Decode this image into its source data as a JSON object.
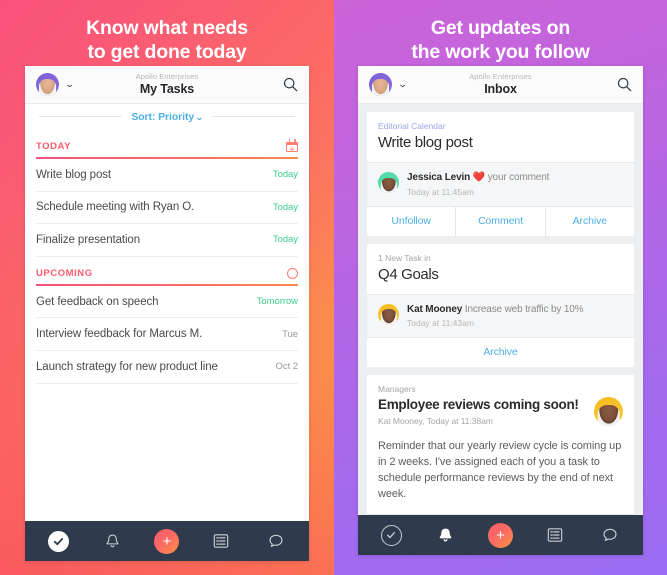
{
  "left": {
    "headline_line1": "Know what needs",
    "headline_line2": "to get done today",
    "appbar": {
      "org": "Apollo Enterprises",
      "title": "My Tasks",
      "avatar": "user-avatar",
      "chevron": "chevron-down-icon",
      "search": "search-icon"
    },
    "sort": {
      "label": "Sort: Priority",
      "chevron": "⌄"
    },
    "sections": [
      {
        "label": "TODAY",
        "icon": "calendar-icon",
        "tasks": [
          {
            "name": "Write blog post",
            "date": "Today",
            "tone": "green"
          },
          {
            "name": "Schedule meeting with Ryan O.",
            "date": "Today",
            "tone": "green"
          },
          {
            "name": "Finalize presentation",
            "date": "Today",
            "tone": "green"
          }
        ]
      },
      {
        "label": "UPCOMING",
        "icon": "circle-icon",
        "tasks": [
          {
            "name": "Get feedback on speech",
            "date": "Tomorrow",
            "tone": "green"
          },
          {
            "name": "Interview feedback for Marcus M.",
            "date": "Tue",
            "tone": "gray"
          },
          {
            "name": "Launch strategy for new product line",
            "date": "Oct 2",
            "tone": "gray"
          }
        ]
      }
    ],
    "tabbar": [
      {
        "icon": "check-circle-icon",
        "state": "active"
      },
      {
        "icon": "bell-icon",
        "state": "inactive"
      },
      {
        "icon": "plus-icon",
        "state": "fab"
      },
      {
        "icon": "list-icon",
        "state": "inactive"
      },
      {
        "icon": "chat-bubble-icon",
        "state": "inactive"
      }
    ]
  },
  "right": {
    "headline_line1": "Get updates on",
    "headline_line2": "the work you follow",
    "appbar": {
      "org": "Apollo Enterprises",
      "title": "Inbox",
      "avatar": "user-avatar",
      "chevron": "chevron-down-icon",
      "search": "search-icon"
    },
    "cards": [
      {
        "subtitle": "Editorial Calendar",
        "subtitle_tone": "blue",
        "title": "Write blog post",
        "row": {
          "avatar": "green",
          "author": "Jessica Levin",
          "emoji": "❤️",
          "action": "your comment",
          "time": "Today at 11:45am"
        },
        "actions": [
          "Unfollow",
          "Comment",
          "Archive"
        ]
      },
      {
        "subtitle": "1 New Task in",
        "subtitle_tone": "gray",
        "title": "Q4 Goals",
        "row": {
          "avatar": "gold",
          "author": "Kat Mooney",
          "action": "Increase web traffic by 10%",
          "time": "Today at 11:43am"
        },
        "actions": [
          "Archive"
        ]
      },
      {
        "subtitle": "Managers",
        "subtitle_tone": "gray",
        "title": "Employee reviews coming soon!",
        "meta": "Kat Mooney, Today at 11:38am",
        "avatar": "gold",
        "body": "Reminder that our yearly review cycle is coming up in 2 weeks. I've assigned each of you a task to schedule performance reviews by the end of next week.",
        "actions": [
          "",
          "",
          ""
        ]
      }
    ],
    "tabbar": [
      {
        "icon": "check-circle-icon",
        "state": "inactive"
      },
      {
        "icon": "bell-icon",
        "state": "active"
      },
      {
        "icon": "plus-icon",
        "state": "fab"
      },
      {
        "icon": "list-icon",
        "state": "inactive"
      },
      {
        "icon": "chat-bubble-icon",
        "state": "inactive"
      }
    ]
  },
  "colors": {
    "accent_pink": "#fb5c6d",
    "accent_orange": "#fba03e",
    "link_blue": "#4fb0e8",
    "due_green": "#3ecf8e",
    "tabbar_navy": "#2f3b4d",
    "purple": "#a46aee"
  }
}
